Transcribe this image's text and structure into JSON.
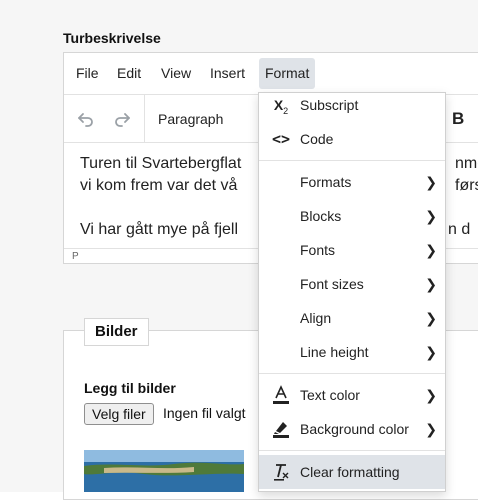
{
  "field": {
    "label": "Turbeskrivelse"
  },
  "menubar": {
    "items": [
      "File",
      "Edit",
      "View",
      "Insert",
      "Format"
    ],
    "active": "Format"
  },
  "toolbar": {
    "undo_icon": "undo-icon",
    "redo_icon": "redo-icon",
    "block_format": "Paragraph",
    "bold_label": "B"
  },
  "content": {
    "line1": "Turen til Svartebergflat",
    "line1_tail": "nme",
    "line2": "vi kom frem var det vå",
    "line2_tail": "førs",
    "line3": "Vi har gått mye på fjell",
    "line3_tail": "n d"
  },
  "statusbar": {
    "path": "P"
  },
  "format_menu": {
    "items": [
      {
        "icon": "subscript-icon",
        "label": "Subscript",
        "submenu": false
      },
      {
        "icon": "code-icon",
        "label": "Code",
        "submenu": false
      },
      {
        "icon": "",
        "label": "Formats",
        "submenu": true
      },
      {
        "icon": "",
        "label": "Blocks",
        "submenu": true
      },
      {
        "icon": "",
        "label": "Fonts",
        "submenu": true
      },
      {
        "icon": "",
        "label": "Font sizes",
        "submenu": true
      },
      {
        "icon": "",
        "label": "Align",
        "submenu": true
      },
      {
        "icon": "",
        "label": "Line height",
        "submenu": true
      },
      {
        "icon": "text-color-icon",
        "label": "Text color",
        "submenu": true
      },
      {
        "icon": "background-color-icon",
        "label": "Background color",
        "submenu": true
      },
      {
        "icon": "clear-formatting-icon",
        "label": "Clear formatting",
        "submenu": false
      }
    ],
    "highlighted": "Clear formatting"
  },
  "images_section": {
    "legend": "Bilder",
    "add_label": "Legg til bilder",
    "file_button": "Velg filer",
    "no_file": "Ingen fil valgt"
  }
}
